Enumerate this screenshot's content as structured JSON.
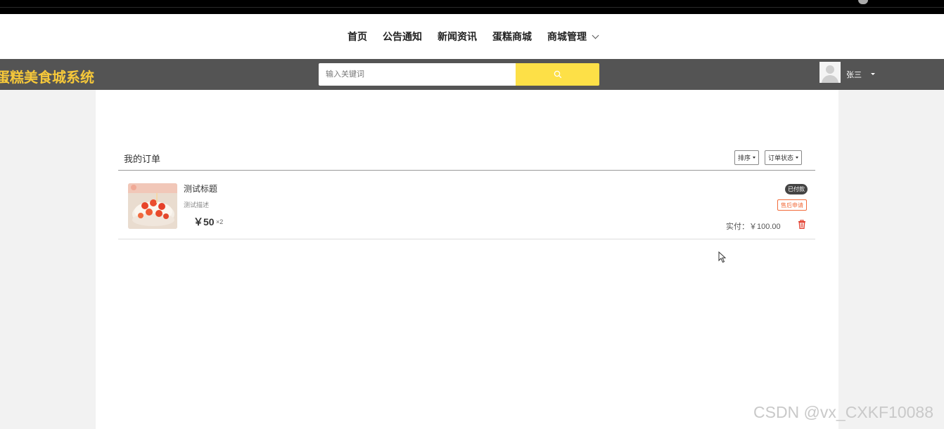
{
  "nav": {
    "items": [
      "首页",
      "公告通知",
      "新闻资讯",
      "蛋糕商城",
      "商城管理"
    ]
  },
  "header": {
    "brand": "蛋糕美食城系统",
    "search_placeholder": "输入关键词",
    "username": "张三",
    "accent_color": "#fde047",
    "brand_color": "#f6c83a"
  },
  "orders": {
    "title": "我的订单",
    "sort_label": "排序",
    "status_filter_label": "订单状态",
    "items": [
      {
        "title": "测试标题",
        "description": "测试描述",
        "price": "￥50",
        "quantity": "×2",
        "status": "已付款",
        "after_sale_label": "售后申请",
        "paid_total": "实付：￥100.00"
      }
    ]
  },
  "watermark": "CSDN @vx_CXKF10088"
}
